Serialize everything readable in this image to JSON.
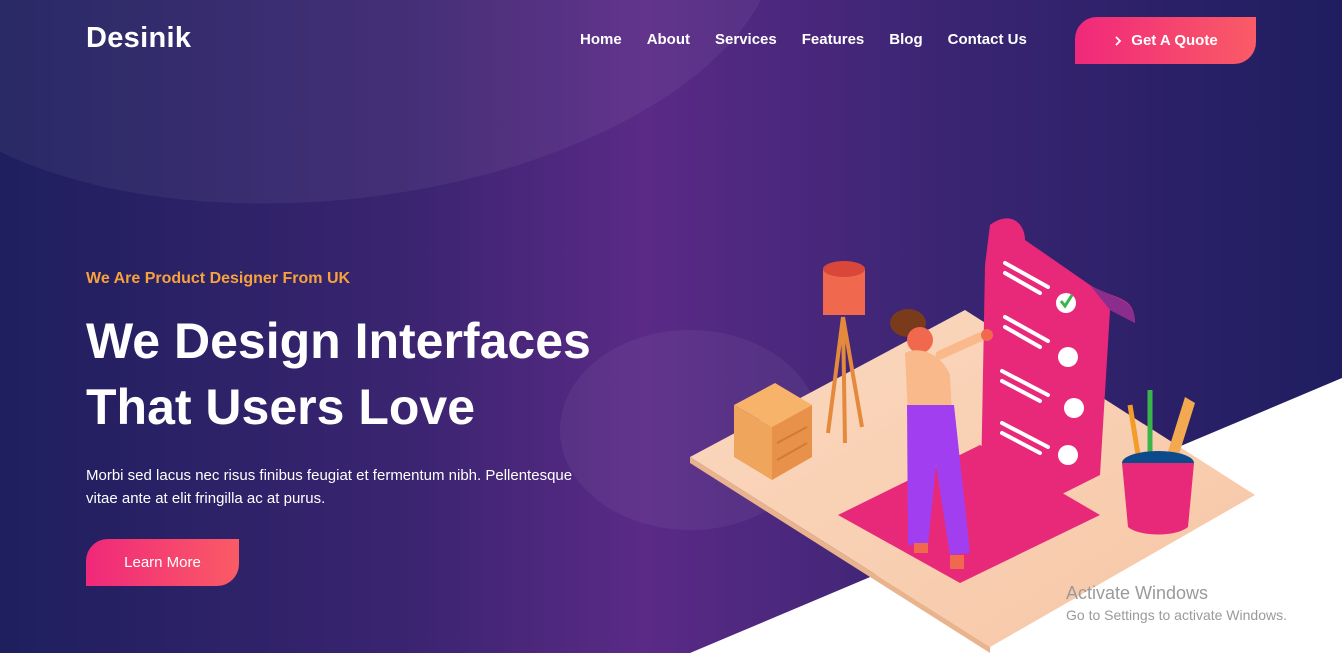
{
  "header": {
    "logo": "Desinik",
    "nav": [
      "Home",
      "About",
      "Services",
      "Features",
      "Blog",
      "Contact Us"
    ],
    "cta_label": "Get A Quote"
  },
  "hero": {
    "tagline": "We Are Product Designer From UK",
    "title_line1": "We Design Interfaces",
    "title_line2": "That Users Love",
    "description_line1": "Morbi sed lacus nec risus finibus feugiat et fermentum nibh. Pellentesque",
    "description_line2": "vitae ante at elit fringilla ac at purus.",
    "button_label": "Learn More"
  },
  "watermark": {
    "title": "Activate Windows",
    "subtitle": "Go to Settings to activate Windows."
  },
  "colors": {
    "accent_pink": "#f0287a",
    "accent_coral": "#fa5b66",
    "tagline_orange": "#f7a23b",
    "bg_purple": "#5a2a86"
  }
}
